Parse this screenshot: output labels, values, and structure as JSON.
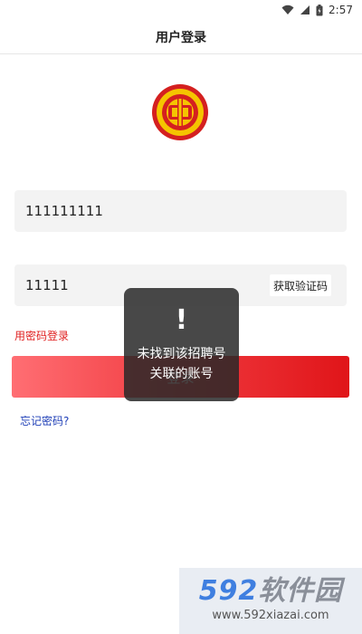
{
  "status_bar": {
    "time": "2:57"
  },
  "header": {
    "title": "用户登录"
  },
  "form": {
    "account_value": "111111111",
    "code_value": "11111",
    "get_code_label": "获取验证码",
    "password_login_label": "用密码登录",
    "login_label": "登录",
    "forgot_password_label": "忘记密码?"
  },
  "toast": {
    "icon": "!",
    "message": "未找到该招聘号关联的账号"
  },
  "watermark": {
    "brand_number": "592",
    "brand_text": "软件园",
    "url": "www.592xiazai.com"
  },
  "icons": {
    "wifi": "wifi-icon",
    "signal": "signal-icon",
    "battery": "battery-icon",
    "logo": "union-emblem-icon"
  },
  "colors": {
    "accent_red": "#e02020",
    "link_blue": "#1f3fb7",
    "button_gradient_start": "#ff6e73",
    "button_gradient_end": "#e01519"
  }
}
